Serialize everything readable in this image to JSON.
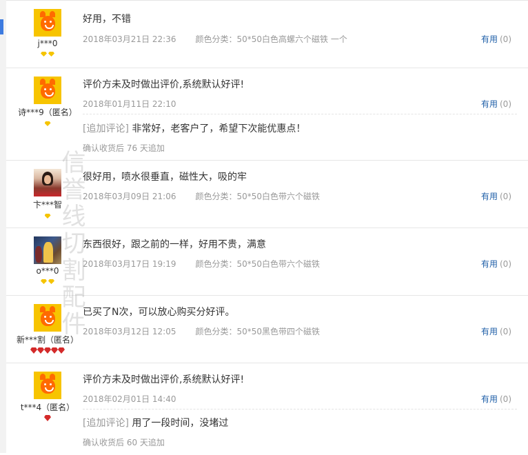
{
  "useful_label": "有用",
  "append_prefix": "[追加评论]",
  "reviews": [
    {
      "user": "j***0",
      "text": "好用，不错",
      "date": "2018年03月21日 22:36",
      "sku": "颜色分类：50*50白色高螺六个磁铁 一个",
      "useful_count": "(0)"
    },
    {
      "user": "诗***9（匿名）",
      "text": "评价方未及时做出评价,系统默认好评!",
      "date": "2018年01月11日 22:10",
      "sku": "",
      "useful_count": "(0)",
      "append_text": "非常好，老客户了，希望下次能优惠点！",
      "append_note": "确认收货后 76 天追加"
    },
    {
      "user": "卞***智",
      "text": "很好用，喷水很垂直，磁性大，吸的牢",
      "date": "2018年03月09日 21:06",
      "sku": "颜色分类：50*50白色带六个磁铁",
      "useful_count": "(0)"
    },
    {
      "user": "o***0",
      "text": "东西很好，跟之前的一样，好用不贵，满意",
      "date": "2018年03月17日 19:19",
      "sku": "颜色分类：50*50白色带六个磁铁",
      "useful_count": "(0)"
    },
    {
      "user": "新***割（匿名）",
      "text": "已买了N次，可以放心购买分好评。",
      "date": "2018年03月12日 12:05",
      "sku": "颜色分类：50*50黑色带四个磁铁",
      "useful_count": "(0)"
    },
    {
      "user": "t***4（匿名）",
      "text": "评价方未及时做出评价,系统默认好评!",
      "date": "2018年02月01日 14:40",
      "sku": "",
      "useful_count": "(0)",
      "append_text": "用了一段时间，没堵过",
      "append_note": "确认收货后 60 天追加"
    }
  ],
  "watermark": "信誉线切割配件",
  "icons": {
    "avatar_default": "orange-mascot-avatar",
    "level_diamond": "yellow-diamond-icon",
    "level_heart": "red-heart-icon"
  },
  "colors": {
    "link": "#1f5fa8",
    "muted": "#999999",
    "text": "#333333",
    "diamond": "#f5c400",
    "heart": "#d42a2a"
  }
}
